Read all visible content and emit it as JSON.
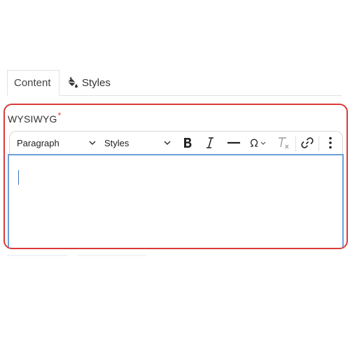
{
  "tabs": [
    {
      "label": "Content",
      "active": true
    },
    {
      "label": "Styles",
      "active": false,
      "icon": "paint-bucket-icon"
    }
  ],
  "field": {
    "label": "WYSIWYG",
    "required_mark": "*",
    "error_color": "#d93a3a"
  },
  "toolbar": {
    "paragraph_select": "Paragraph",
    "styles_select": "Styles",
    "buttons": [
      "bold-icon",
      "italic-icon",
      "horizontal-line-icon",
      "special-character-icon",
      "remove-format-icon",
      "link-icon",
      "more-vertical-icon"
    ]
  },
  "editor": {
    "content": "",
    "focus_color": "#6a9fd8"
  }
}
